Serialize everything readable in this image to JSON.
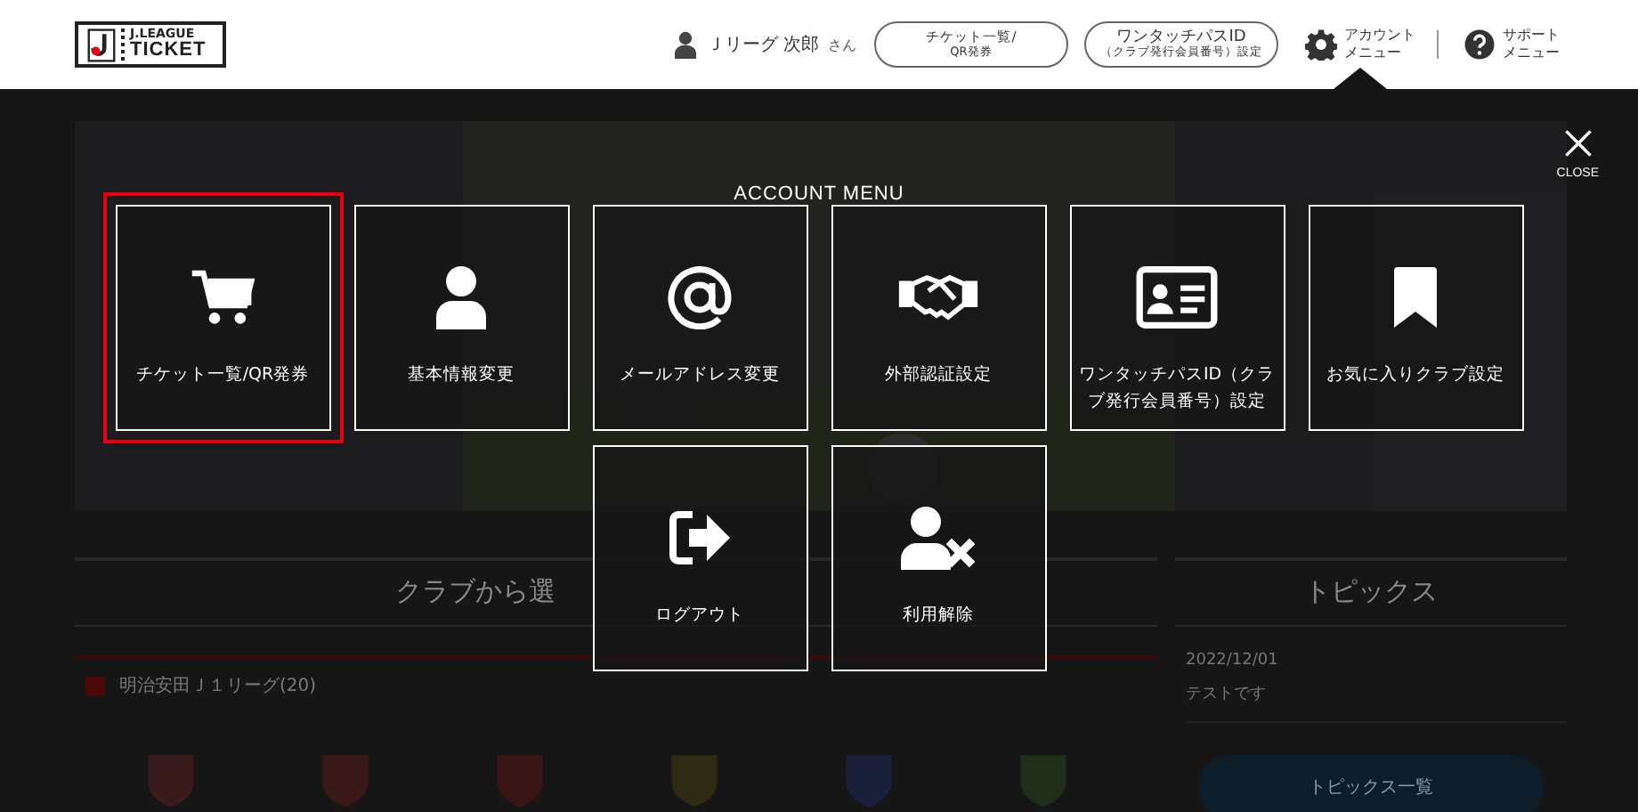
{
  "header": {
    "logo": {
      "line1": "J.LEAGUE",
      "line2": "TICKET"
    },
    "user": {
      "name": "Ｊリーグ 次郎",
      "suffix": "さん"
    },
    "buttons": [
      {
        "line1": "チケット一覧/",
        "line2": "QR発券"
      },
      {
        "line1": "ワンタッチパスID",
        "line2": "（クラブ発行会員番号）設定"
      }
    ],
    "menus": [
      {
        "line1": "アカウント",
        "line2": "メニュー",
        "selected": true
      },
      {
        "line1": "サポート",
        "line2": "メニュー",
        "selected": false
      }
    ]
  },
  "background": {
    "clubs": {
      "heading": "クラブから選",
      "league": "明治安田Ｊ１リーグ(20)"
    },
    "topics": {
      "heading": "トピックス",
      "date": "2022/12/01",
      "text": "テストです",
      "button": "トピックス一覧"
    }
  },
  "account_menu": {
    "title": "ACCOUNT MENU",
    "close": "CLOSE",
    "rows": [
      [
        {
          "label": "チケット一覧/QR発券",
          "selected": true
        },
        {
          "label": "基本情報変更",
          "selected": false
        },
        {
          "label": "メールアドレス変更",
          "selected": false
        },
        {
          "label": "外部認証設定",
          "selected": false
        },
        {
          "label": "ワンタッチパスID（クラブ発行会員番号）設定",
          "selected": false
        },
        {
          "label": "お気に入りクラブ設定",
          "selected": false
        }
      ],
      [
        "",
        "",
        {
          "label": "ログアウト",
          "selected": false
        },
        {
          "label": "利用解除",
          "selected": false
        }
      ]
    ]
  }
}
